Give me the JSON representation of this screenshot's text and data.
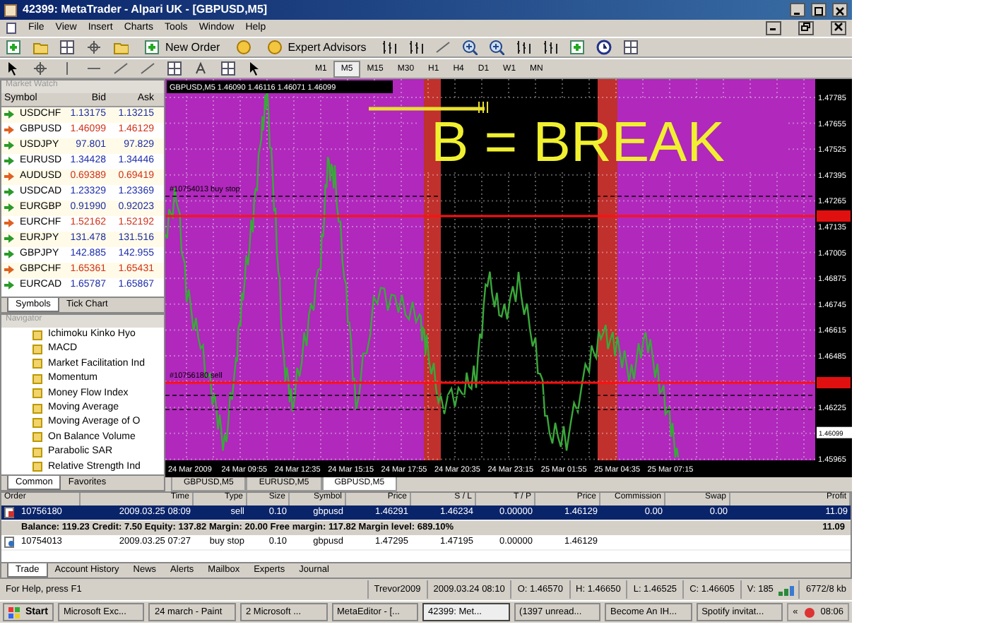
{
  "window": {
    "title": "42399: MetaTrader - Alpari UK - [GBPUSD,M5]"
  },
  "menu": [
    "File",
    "View",
    "Insert",
    "Charts",
    "Tools",
    "Window",
    "Help"
  ],
  "toolbar": {
    "buttons": [
      "New Order",
      "Expert Advisors"
    ],
    "timeframes": [
      {
        "label": "M1",
        "selected": false
      },
      {
        "label": "M5",
        "selected": true
      },
      {
        "label": "M15",
        "selected": false
      },
      {
        "label": "M30",
        "selected": false
      },
      {
        "label": "H1",
        "selected": false
      },
      {
        "label": "H4",
        "selected": false
      },
      {
        "label": "D1",
        "selected": false
      },
      {
        "label": "W1",
        "selected": false
      },
      {
        "label": "MN",
        "selected": false
      }
    ]
  },
  "market_watch": {
    "title": "Market Watch",
    "columns": [
      "Symbol",
      "Bid",
      "Ask"
    ],
    "rows": [
      {
        "symbol": "USDCHF",
        "bid": "1.13175",
        "ask": "1.13215",
        "kind": "up"
      },
      {
        "symbol": "GBPUSD",
        "bid": "1.46099",
        "ask": "1.46129",
        "kind": "down"
      },
      {
        "symbol": "USDJPY",
        "bid": "97.801",
        "ask": "97.829",
        "kind": "up"
      },
      {
        "symbol": "EURUSD",
        "bid": "1.34428",
        "ask": "1.34446",
        "kind": "up"
      },
      {
        "symbol": "AUDUSD",
        "bid": "0.69389",
        "ask": "0.69419",
        "kind": "down"
      },
      {
        "symbol": "USDCAD",
        "bid": "1.23329",
        "ask": "1.23369",
        "kind": "up"
      },
      {
        "symbol": "EURGBP",
        "bid": "0.91990",
        "ask": "0.92023",
        "kind": "up"
      },
      {
        "symbol": "EURCHF",
        "bid": "1.52162",
        "ask": "1.52192",
        "kind": "down"
      },
      {
        "symbol": "EURJPY",
        "bid": "131.478",
        "ask": "131.516",
        "kind": "up"
      },
      {
        "symbol": "GBPJPY",
        "bid": "142.885",
        "ask": "142.955",
        "kind": "up"
      },
      {
        "symbol": "GBPCHF",
        "bid": "1.65361",
        "ask": "1.65431",
        "kind": "down"
      },
      {
        "symbol": "EURCAD",
        "bid": "1.65787",
        "ask": "1.65867",
        "kind": "up"
      }
    ],
    "tabs": [
      {
        "label": "Symbols",
        "selected": true
      },
      {
        "label": "Tick Chart",
        "selected": false
      }
    ]
  },
  "navigator": {
    "title": "Navigator",
    "items": [
      "Ichimoku Kinko Hyo",
      "MACD",
      "Market Facilitation Ind",
      "Momentum",
      "Money Flow Index",
      "Moving Average",
      "Moving Average of O",
      "On Balance Volume",
      "Parabolic SAR",
      "Relative Strength Ind"
    ],
    "tabs": [
      {
        "label": "Common",
        "selected": true
      },
      {
        "label": "Favorites",
        "selected": false
      }
    ]
  },
  "chart": {
    "header": "GBPUSD,M5  1.46090 1.46116 1.46071 1.46099",
    "annotation": "B = BREAK",
    "order_labels": [
      "#10754013 buy stop",
      "#10756180 sell"
    ],
    "price_labels": [
      "1.47785",
      "1.47655",
      "1.47525",
      "1.47395",
      "1.47265",
      "1.47135",
      "1.47005",
      "1.46875",
      "1.46745",
      "1.46615",
      "1.46485",
      "1.46225",
      "1.45965"
    ],
    "current_price": "1.46099",
    "time_labels": [
      "24 Mar 2009",
      "24 Mar 09:55",
      "24 Mar 12:35",
      "24 Mar 15:15",
      "24 Mar 17:55",
      "24 Mar 20:35",
      "24 Mar 23:15",
      "25 Mar 01:55",
      "25 Mar 04:35",
      "25 Mar 07:15"
    ],
    "tabs": [
      {
        "label": "GBPUSD,M5",
        "selected": false
      },
      {
        "label": "EURUSD,M5",
        "selected": false
      },
      {
        "label": "GBPUSD,M5",
        "selected": true
      }
    ]
  },
  "terminal": {
    "columns": [
      "Order",
      "Time",
      "Type",
      "Size",
      "Symbol",
      "Price",
      "S / L",
      "T / P",
      "Price",
      "Commission",
      "Swap",
      "Profit"
    ],
    "rows": [
      {
        "kind": "order",
        "selected": true,
        "cells": [
          "10756180",
          "2009.03.25 08:09",
          "sell",
          "0.10",
          "gbpusd",
          "1.46291",
          "1.46234",
          "0.00000",
          "1.46129",
          "0.00",
          "0.00",
          "11.09"
        ]
      },
      {
        "kind": "summary",
        "selected": false,
        "text": "Balance: 119.23  Credit: 7.50  Equity: 137.82  Margin: 20.00  Free margin: 117.82  Margin level: 689.10%",
        "total": "11.09"
      },
      {
        "kind": "pending",
        "selected": false,
        "cells": [
          "10754013",
          "2009.03.25 07:27",
          "buy stop",
          "0.10",
          "gbpusd",
          "1.47295",
          "1.47195",
          "0.00000",
          "1.46129"
        ]
      }
    ],
    "tabs": [
      {
        "label": "Trade",
        "selected": true
      },
      {
        "label": "Account History",
        "selected": false
      },
      {
        "label": "News",
        "selected": false
      },
      {
        "label": "Alerts",
        "selected": false
      },
      {
        "label": "Mailbox",
        "selected": false
      },
      {
        "label": "Experts",
        "selected": false
      },
      {
        "label": "Journal",
        "selected": false
      }
    ]
  },
  "status_bar": [
    "For Help, press F1",
    "Trevor2009",
    "2009.03.24 08:10",
    "O: 1.46570",
    "H: 1.46650",
    "L: 1.46525",
    "C: 1.46605",
    "V: 185",
    "6772/8 kb"
  ],
  "taskbar": {
    "start": "Start",
    "items": [
      {
        "label": "Microsoft Exc...",
        "selected": false
      },
      {
        "label": "24 march - Paint",
        "selected": false
      },
      {
        "label": "2 Microsoft ...",
        "selected": false
      },
      {
        "label": "MetaEditor - [...",
        "selected": false
      },
      {
        "label": "42399: Met...",
        "selected": true
      },
      {
        "label": "(1397 unread...",
        "selected": false
      },
      {
        "label": "Become An IH...",
        "selected": false
      },
      {
        "label": "Spotify invitat...",
        "selected": false
      }
    ],
    "tray_toggle": "«",
    "clock": "08:06"
  }
}
